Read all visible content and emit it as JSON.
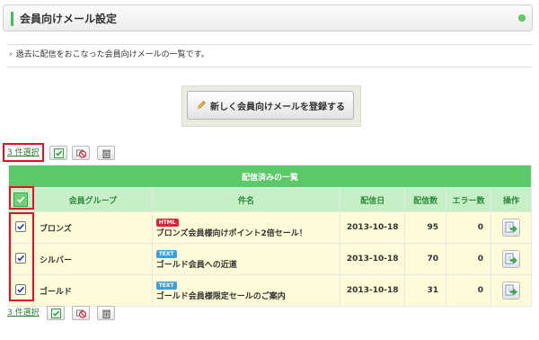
{
  "header": {
    "title": "会員向けメール設定"
  },
  "description": "過去に配信をおこなった会員向けメールの一覧です。",
  "register_button": {
    "label": "新しく会員向けメールを登録する"
  },
  "selection": {
    "count_text": "3 件選択"
  },
  "table": {
    "caption": "配信済みの一覧",
    "columns": [
      "会員グループ",
      "件名",
      "配信日",
      "配信数",
      "エラー数",
      "操作"
    ],
    "rows": [
      {
        "group": "ブロンズ",
        "badge": "HTML",
        "subject": "ブロンズ会員様向けポイント2倍セール！",
        "date": "2013-10-18",
        "sent": "95",
        "errors": "0",
        "checked": true
      },
      {
        "group": "シルバー",
        "badge": "TEXT",
        "subject": "ゴールド会員への近道",
        "date": "2013-10-18",
        "sent": "70",
        "errors": "0",
        "checked": true
      },
      {
        "group": "ゴールド",
        "badge": "TEXT",
        "subject": "ゴールド会員様限定セールのご案内",
        "date": "2013-10-18",
        "sent": "31",
        "errors": "0",
        "checked": true
      }
    ]
  },
  "icons": {
    "header_dot": "circle-icon",
    "toolbar": [
      "check-icon",
      "unsubscribe-icon",
      "trash-icon"
    ],
    "row_action": "open-icon"
  },
  "colors": {
    "accent": "#5cc867",
    "header_row": "#c6efc8",
    "row_bg": "#fefbd9",
    "highlight": "#e0102a",
    "html_badge": "#d6263b",
    "text_badge": "#3ea0d8"
  }
}
